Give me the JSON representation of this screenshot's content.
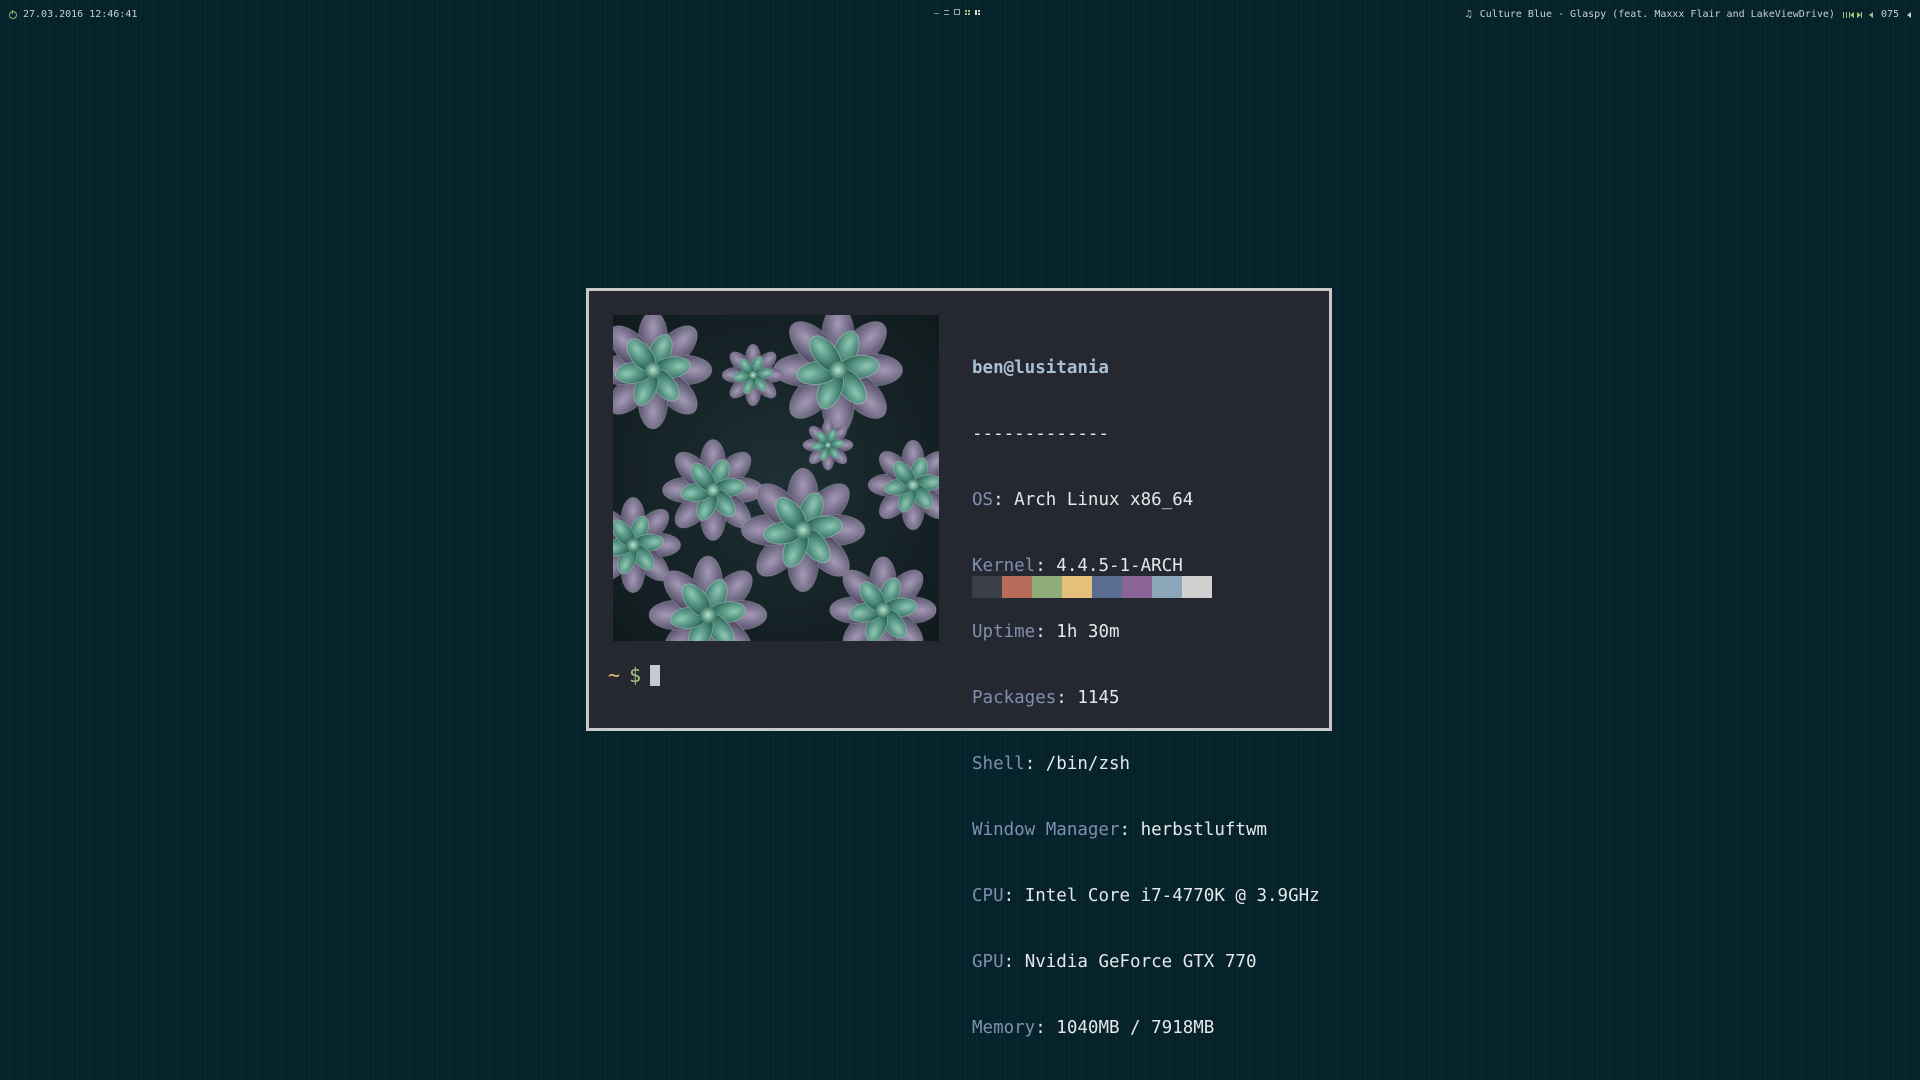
{
  "statusbar": {
    "datetime": "27.03.2016 12:46:41",
    "now_playing": "Culture Blue - Glaspy (feat. Maxxx Flair and LakeViewDrive)",
    "volume": "075",
    "icons": {
      "left": "power-icon",
      "music": "music-note-icon",
      "controls": [
        "pause-icon",
        "previous-icon",
        "next-icon"
      ],
      "volume": "volume-icon",
      "end": "speaker-icon"
    },
    "workspace_icons": [
      "dash-icon",
      "lines-icon",
      "box-icon",
      "grid-icon",
      "split-icon"
    ],
    "colors": {
      "accent": "#a7c080",
      "text": "#c9cfd6"
    }
  },
  "terminal": {
    "colors": {
      "background": "#252830",
      "border": "#c8c8c8",
      "key": "#7e8fb0",
      "title": "#a9bfd6",
      "text": "#e5e7ea",
      "prompt_tilde": "#e2c27a",
      "prompt_dollar": "#a3c282"
    },
    "sysinfo": {
      "title": "ben@lusitania",
      "separator": "-------------",
      "rows": [
        {
          "key": "OS",
          "value": "Arch Linux x86_64"
        },
        {
          "key": "Kernel",
          "value": "4.4.5-1-ARCH"
        },
        {
          "key": "Uptime",
          "value": "1h 30m"
        },
        {
          "key": "Packages",
          "value": "1145"
        },
        {
          "key": "Shell",
          "value": "/bin/zsh"
        },
        {
          "key": "Window Manager",
          "value": "herbstluftwm"
        },
        {
          "key": "CPU",
          "value": "Intel Core i7-4770K @ 3.9GHz"
        },
        {
          "key": "GPU",
          "value": "Nvidia GeForce GTX 770"
        },
        {
          "key": "Memory",
          "value": "1040MB / 7918MB"
        }
      ],
      "key_value_separator": ": "
    },
    "palette": [
      "#3a3f4a",
      "#b86d5a",
      "#8fad7a",
      "#e5c07b",
      "#5c6d94",
      "#8a6496",
      "#8aa6b8",
      "#d0d0d0"
    ],
    "prompt": {
      "tilde": "~",
      "dollar": "$"
    },
    "image": "succulent-photo"
  }
}
